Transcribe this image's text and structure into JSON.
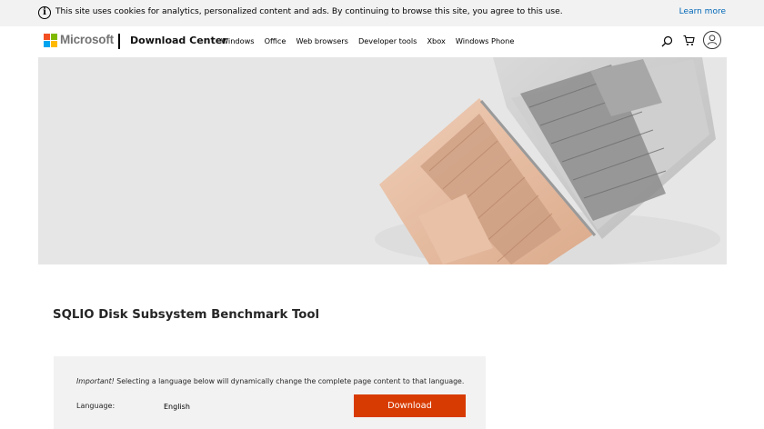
{
  "cookie_bar": {
    "icon": "info-icon",
    "message": "This site uses cookies for analytics, personalized content and ads. By continuing to browse this site, you agree to this use.",
    "learn_more": "Learn more"
  },
  "header": {
    "brand": "Microsoft",
    "site_title": "Download Center",
    "nav": [
      "Windows",
      "Office",
      "Web browsers",
      "Developer tools",
      "Xbox",
      "Windows Phone"
    ],
    "icons": [
      "search-icon",
      "cart-icon",
      "account-icon"
    ]
  },
  "hero": {
    "image": "two-laptops-top-view"
  },
  "page": {
    "title": "SQLIO Disk Subsystem Benchmark Tool"
  },
  "download_panel": {
    "note_emphasis": "Important!",
    "note_text": " Selecting a language below will dynamically change the complete page content to that language.",
    "language_label": "Language:",
    "language_value": "English",
    "download_label": "Download"
  },
  "colors": {
    "accent_link": "#0067b8",
    "download_button": "#d83b01",
    "panel_bg": "#f2f2f2"
  }
}
